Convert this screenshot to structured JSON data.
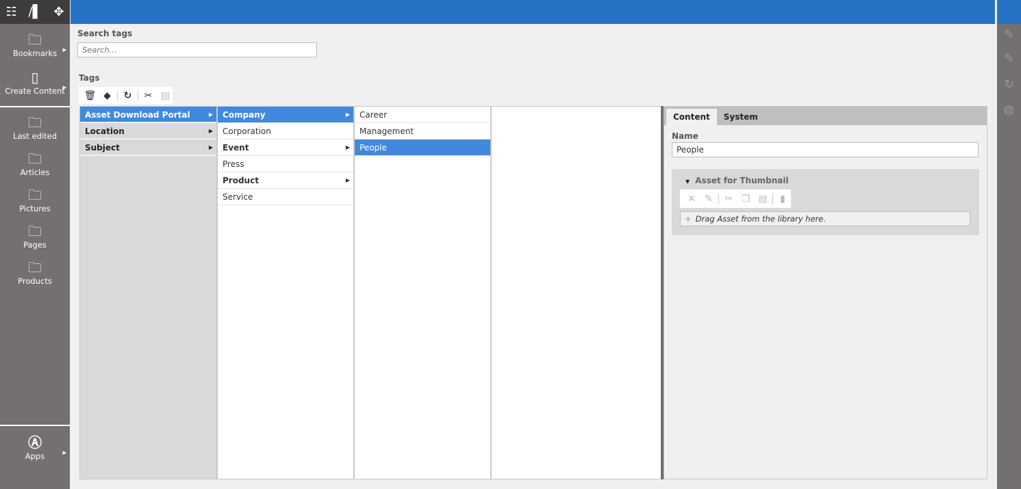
{
  "topbar": {
    "icons": [
      "apps-grid-icon",
      "library-icon",
      "navigate-icon"
    ]
  },
  "sidebar": {
    "items": [
      {
        "label": "Bookmarks",
        "icon": "bookmark-folder-icon"
      },
      {
        "label": "Create Content",
        "icon": "create-content-icon"
      },
      {
        "label": "Last edited",
        "icon": "search-folder-icon"
      },
      {
        "label": "Articles",
        "icon": "search-folder-icon"
      },
      {
        "label": "Pictures",
        "icon": "search-folder-icon"
      },
      {
        "label": "Pages",
        "icon": "search-folder-icon"
      },
      {
        "label": "Products",
        "icon": "search-folder-icon"
      },
      {
        "label": "Apps",
        "icon": "apps-icon"
      }
    ]
  },
  "search": {
    "label": "Search tags",
    "placeholder": "Search..."
  },
  "tags": {
    "label": "Tags",
    "toolbar": [
      "delete-icon",
      "add-tag-icon",
      "refresh-icon",
      "cut-icon",
      "paste-icon"
    ]
  },
  "columns": [
    [
      {
        "label": "Asset Download Portal",
        "bold": true,
        "arrow": true,
        "selected": true
      },
      {
        "label": "Location",
        "bold": true,
        "arrow": true
      },
      {
        "label": "Subject",
        "bold": true,
        "arrow": true
      }
    ],
    [
      {
        "label": "Company",
        "bold": true,
        "arrow": true,
        "selected": true
      },
      {
        "label": "Corporation"
      },
      {
        "label": "Event",
        "bold": true,
        "arrow": true
      },
      {
        "label": "Press"
      },
      {
        "label": "Product",
        "bold": true,
        "arrow": true
      },
      {
        "label": "Service"
      }
    ],
    [
      {
        "label": "Career"
      },
      {
        "label": "Management"
      },
      {
        "label": "People",
        "selected": true
      }
    ]
  ],
  "detail": {
    "tabs": [
      {
        "label": "Content",
        "active": true
      },
      {
        "label": "System"
      }
    ],
    "name_label": "Name",
    "name_value": "People",
    "asset_section": "Asset for Thumbnail",
    "asset_toolbar": [
      "remove-icon",
      "edit-icon",
      "cut-icon",
      "copy-icon",
      "paste-icon",
      "add-document-icon"
    ],
    "drop_text": "Drag Asset from the library here."
  },
  "rightbar": {
    "icons": [
      "checkin-icon",
      "discard-icon",
      "sync-icon",
      "withdraw-icon"
    ]
  },
  "colors": {
    "header": "#2872c6",
    "selected": "#4189dd",
    "sidebar": "#747070"
  }
}
